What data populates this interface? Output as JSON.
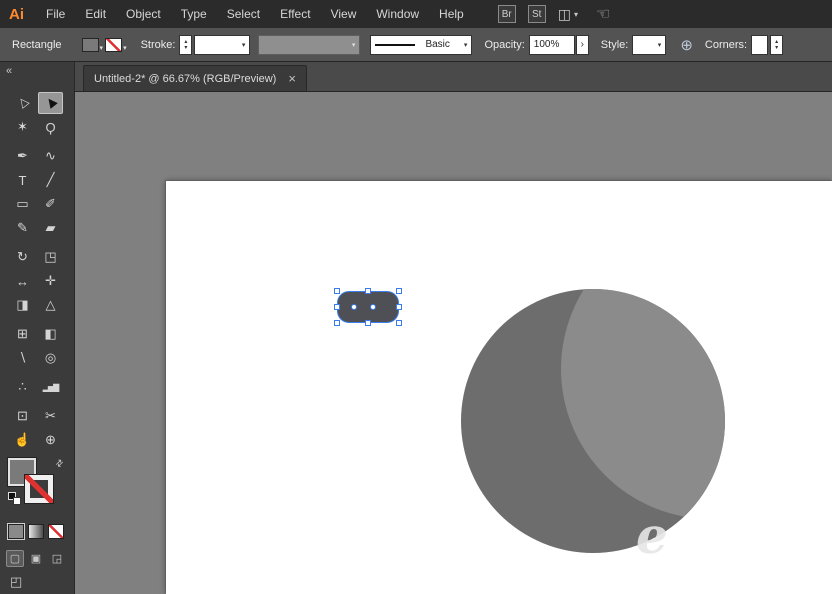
{
  "menu_bar": {
    "logo": "Ai",
    "items": [
      "File",
      "Edit",
      "Object",
      "Type",
      "Select",
      "Effect",
      "View",
      "Window",
      "Help"
    ],
    "bridge": "Br",
    "stock": "St"
  },
  "icons": {
    "caret": "▾",
    "spinner_up": "▴",
    "spinner_down": "▾",
    "arrow_right": "›",
    "swap": "⇄",
    "workspace": "◫",
    "touch": "☜",
    "globe": "⊕"
  },
  "control_bar": {
    "tool_context_label": "Rectangle",
    "stroke_label": "Stroke:",
    "brush_name": "Basic",
    "opacity_label": "Opacity:",
    "opacity_value": "100%",
    "style_label": "Style:",
    "corners_label": "Corners:"
  },
  "tab_bar": {
    "active_tab": "Untitled-2* @ 66.67% (RGB/Preview)",
    "close_glyph": "×"
  },
  "tool_panel": {
    "collapse_glyph": "«",
    "rows": [
      {
        "left": {
          "name": "selection",
          "glyph": "▷",
          "cls": "arrow"
        },
        "right": {
          "name": "direct-selection",
          "glyph": "▶",
          "cls": "arrow",
          "active": true
        }
      },
      {
        "left": {
          "name": "magic-wand",
          "glyph": "✶"
        },
        "right": {
          "name": "lasso",
          "glyph": "Ϙ"
        },
        "gap": true
      },
      {
        "left": {
          "name": "pen",
          "glyph": "✒"
        },
        "right": {
          "name": "curvature",
          "glyph": "∿"
        }
      },
      {
        "left": {
          "name": "type",
          "glyph": "T"
        },
        "right": {
          "name": "line-segment",
          "glyph": "╱"
        }
      },
      {
        "left": {
          "name": "rectangle",
          "glyph": "▭"
        },
        "right": {
          "name": "paintbrush",
          "glyph": "✐"
        }
      },
      {
        "left": {
          "name": "pencil",
          "glyph": "✎"
        },
        "right": {
          "name": "eraser",
          "glyph": "▰"
        },
        "gap": true
      },
      {
        "left": {
          "name": "rotate",
          "glyph": "↻"
        },
        "right": {
          "name": "scale",
          "glyph": "◳"
        }
      },
      {
        "left": {
          "name": "width",
          "glyph": "↔"
        },
        "right": {
          "name": "free-transform",
          "glyph": "✛"
        }
      },
      {
        "left": {
          "name": "shape-builder",
          "glyph": "◨"
        },
        "right": {
          "name": "perspective-grid",
          "glyph": "△"
        },
        "gap": true
      },
      {
        "left": {
          "name": "mesh",
          "glyph": "⊞"
        },
        "right": {
          "name": "gradient",
          "glyph": "◧"
        }
      },
      {
        "left": {
          "name": "eyedropper",
          "glyph": "∖"
        },
        "right": {
          "name": "blend",
          "glyph": "◎"
        },
        "gap": true
      },
      {
        "left": {
          "name": "symbol-sprayer",
          "glyph": "∴"
        },
        "right": {
          "name": "column-graph",
          "glyph": "▂▅▇",
          "cls": "tight"
        },
        "gap": true
      },
      {
        "left": {
          "name": "artboard",
          "glyph": "⊡"
        },
        "right": {
          "name": "slice",
          "glyph": "✂"
        }
      },
      {
        "left": {
          "name": "hand",
          "glyph": "☝"
        },
        "right": {
          "name": "zoom",
          "glyph": "⊕"
        }
      }
    ]
  },
  "bottom_controls": {
    "draw_modes": [
      "▢",
      "▣",
      "◲"
    ],
    "screen_mode_glyph": "◰"
  },
  "canvas": {
    "watermark_glyph": "e"
  },
  "colors": {
    "selection": "#3b7ceb",
    "circle_fill": "#6d6d6d",
    "circle_highlight": "#8b8b8b",
    "shape_fill": "#4e5055",
    "fill_swatch": "#7a7a7a",
    "none_red": "#e03131",
    "logo_orange": "#ff8a2e"
  }
}
